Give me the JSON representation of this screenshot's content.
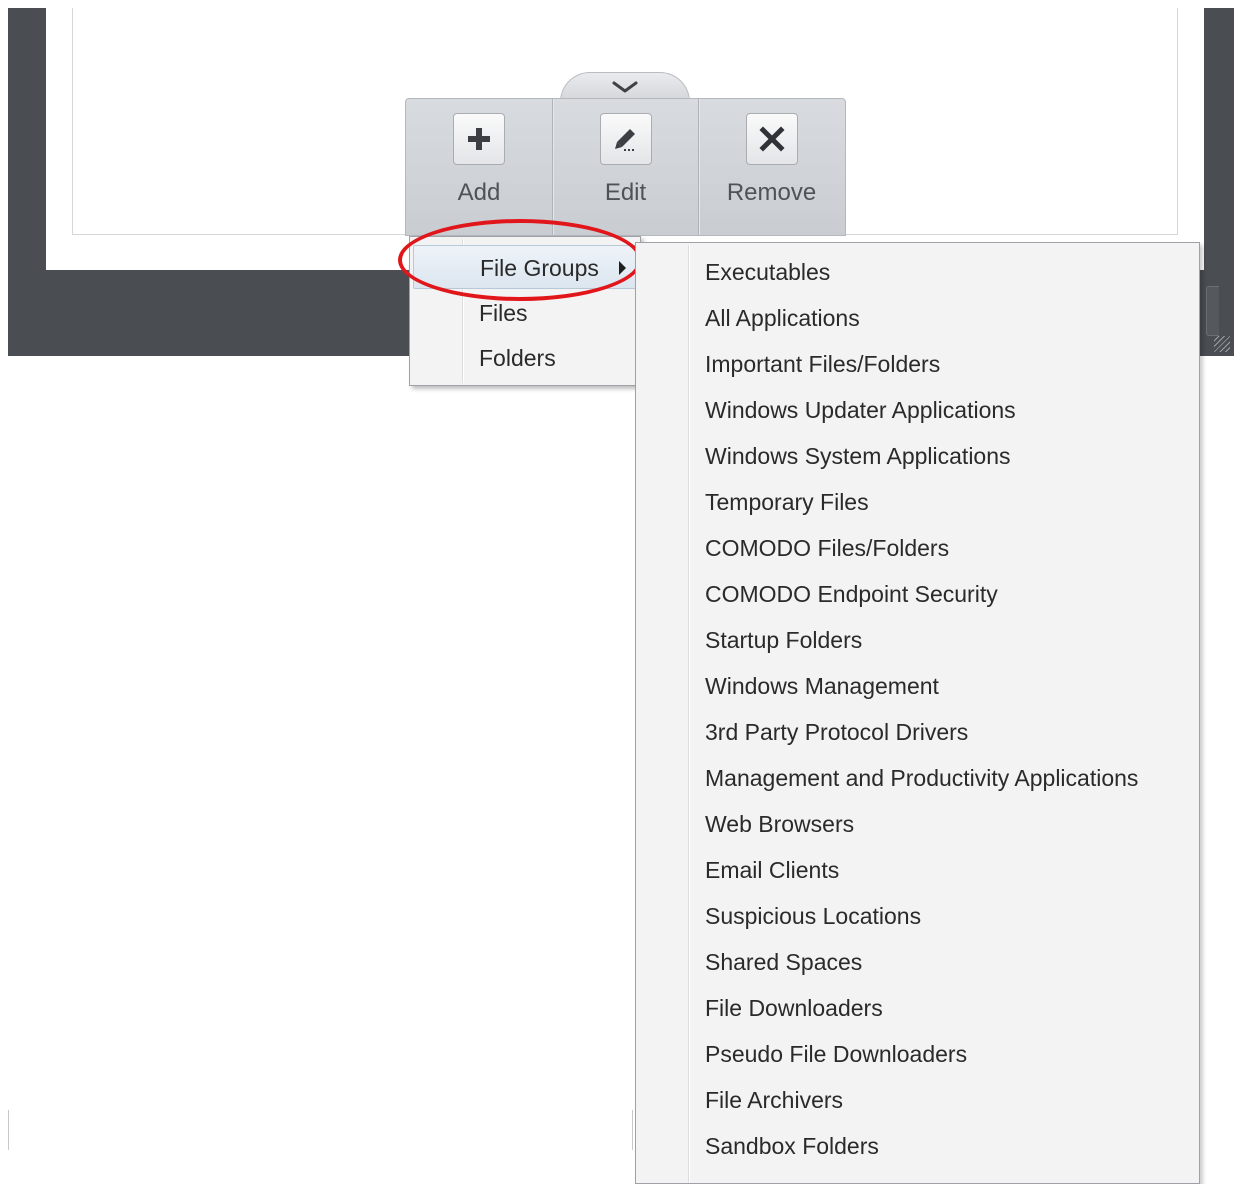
{
  "toolbar": {
    "add_label": "Add",
    "edit_label": "Edit",
    "remove_label": "Remove"
  },
  "add_menu": {
    "items": [
      {
        "label": "File Groups",
        "has_submenu": true,
        "active": true
      },
      {
        "label": "Files"
      },
      {
        "label": "Folders"
      }
    ]
  },
  "file_groups_submenu": {
    "items": [
      "Executables",
      "All Applications",
      "Important Files/Folders",
      "Windows Updater Applications",
      "Windows System Applications",
      "Temporary Files",
      "COMODO Files/Folders",
      "COMODO Endpoint Security",
      "Startup Folders",
      "Windows Management",
      "3rd Party Protocol Drivers",
      "Management and Productivity Applications",
      "Web Browsers",
      "Email Clients",
      "Suspicious Locations",
      "Shared Spaces",
      "File Downloaders",
      "Pseudo File Downloaders",
      "File Archivers",
      "Sandbox Folders"
    ]
  },
  "icons": {
    "toggle": "chevron-down-icon",
    "add": "plus-icon",
    "edit": "pencil-icon",
    "remove": "x-icon",
    "submenu": "triangle-right-icon"
  },
  "colors": {
    "frame": "#4a4d52",
    "toolbar": "#d3d6da",
    "menu_bg": "#f3f3f3",
    "annotation": "#e0161b"
  }
}
